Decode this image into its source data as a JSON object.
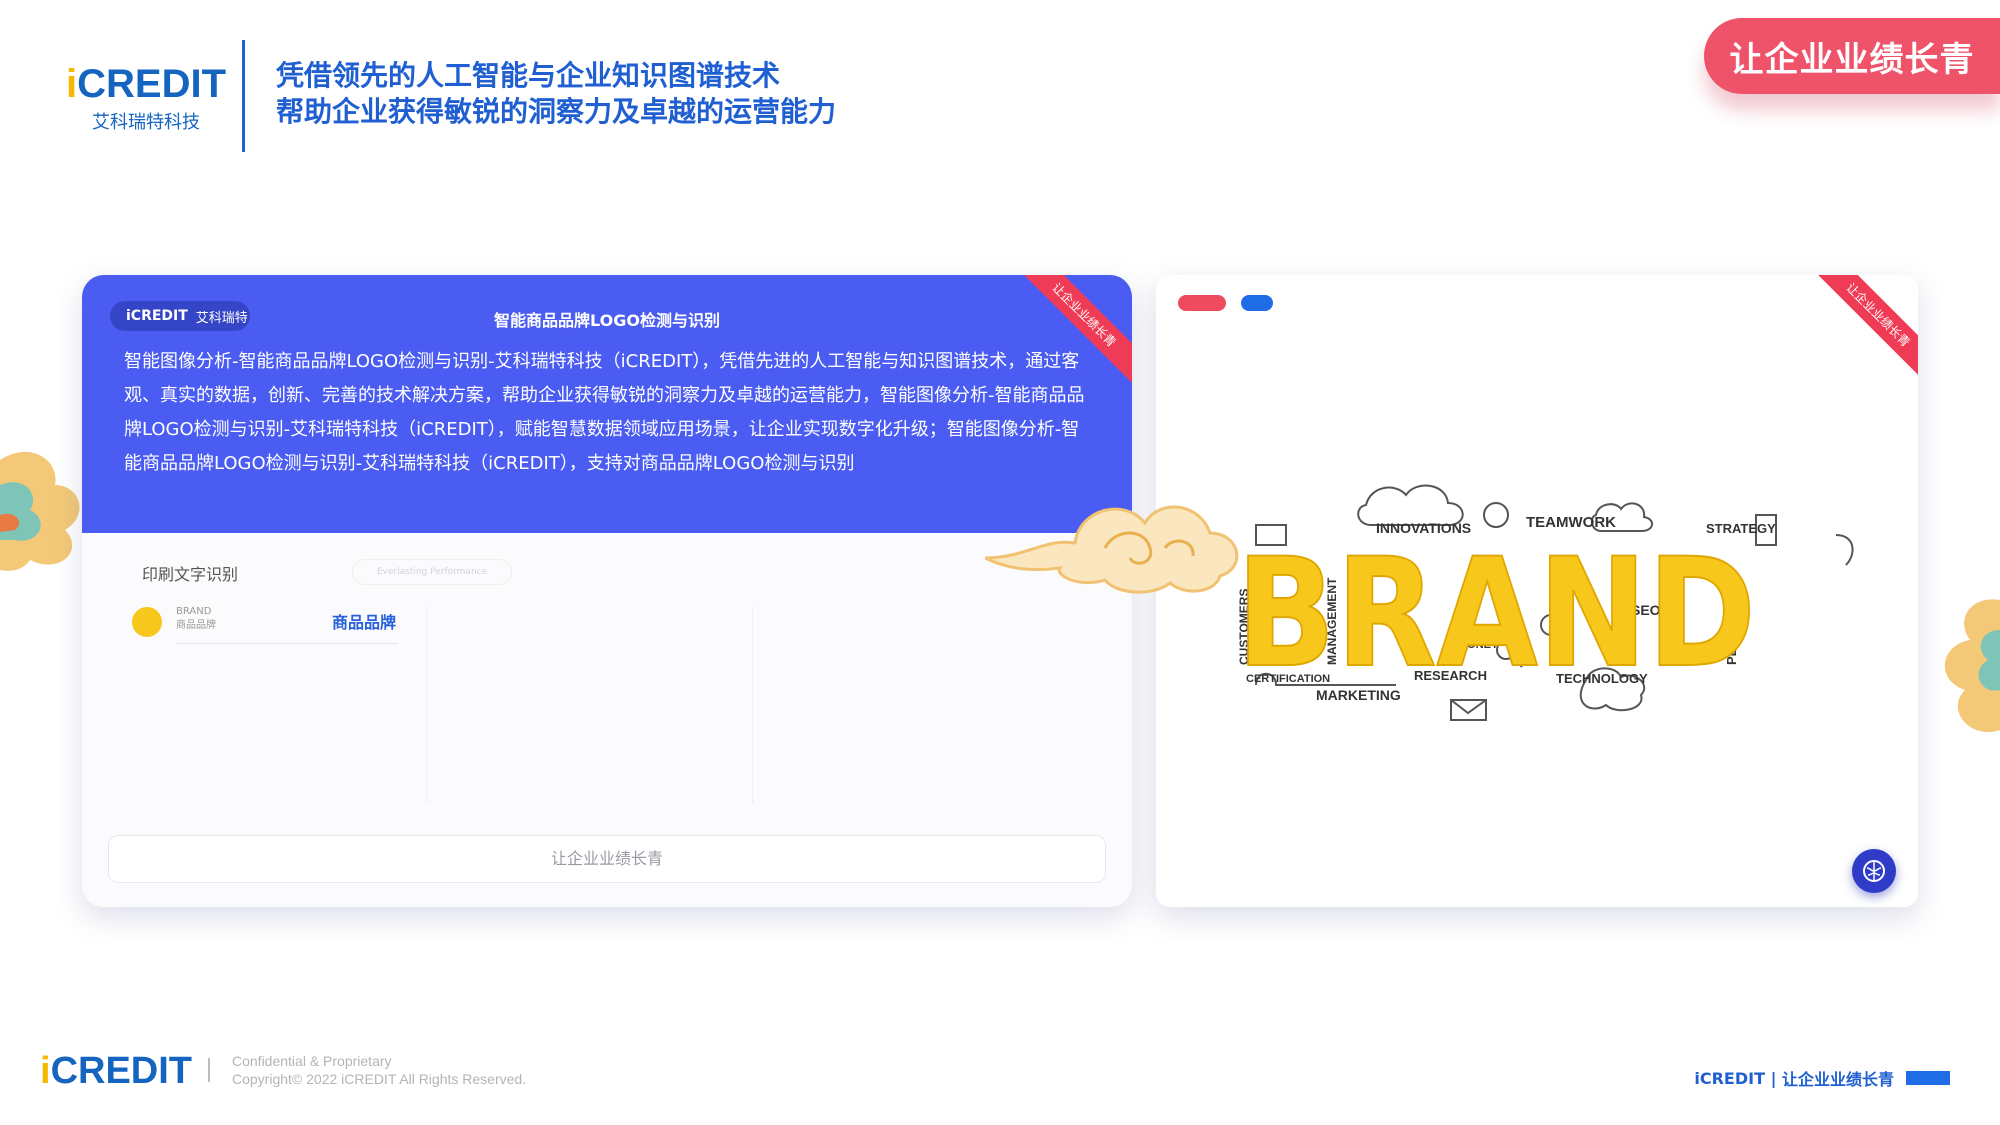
{
  "header": {
    "logo_word_i": "i",
    "logo_word_rest": "CREDIT",
    "logo_sub": "艾科瑞特科技",
    "headline_line1": "凭借领先的人工智能与企业知识图谱技术",
    "headline_line2": "帮助企业获得敏锐的洞察力及卓越的运营能力",
    "slogan": "让企业业绩长青"
  },
  "left_card": {
    "pill_brand": "iCREDIT",
    "pill_sub": "艾科瑞特",
    "title": "智能商品品牌LOGO检测与识别",
    "ribbon": "让企业业绩长青",
    "description": "智能图像分析-智能商品品牌LOGO检测与识别-艾科瑞特科技（iCREDIT），凭借先进的人工智能与知识图谱技术，通过客观、真实的数据，创新、完善的技术解决方案，帮助企业获得敏锐的洞察力及卓越的运营能力，智能图像分析-智能商品品牌LOGO检测与识别-艾科瑞特科技（iCREDIT），赋能智慧数据领域应用场景，让企业实现数字化升级；智能图像分析-智能商品品牌LOGO检测与识别-艾科瑞特科技（iCREDIT），支持对商品品牌LOGO检测与识别",
    "section_label": "印刷文字识别",
    "ghost_pill": "Everlasting Performance",
    "item_en": "BRAND",
    "item_cn": "商品品牌",
    "item_link": "商品品牌",
    "footer_button": "让企业业绩长青"
  },
  "right_card": {
    "ribbon": "让企业业绩长青",
    "image_words": {
      "main": "BRAND",
      "innovations": "INNOVATIONS",
      "teamwork": "TEAMWORK",
      "strategy": "STRATEGY",
      "customers": "CUSTOMERS",
      "management": "MANAGEMENT",
      "seo": "SEO",
      "planning": "PLANNING",
      "money": "MONEY",
      "certification": "CERTIFICATION",
      "research": "RESEARCH",
      "technology": "TECHNOLOGY",
      "marketing": "MARKETING"
    }
  },
  "footer": {
    "logo_i": "i",
    "logo_rest": "CREDIT",
    "copy_line1": "Confidential & Proprietary",
    "copy_line2": "Copyright© 2022 iCREDIT All Rights Reserved.",
    "right_brand": "iCREDIT",
    "right_sep": "|",
    "right_slogan": "让企业业绩长青"
  },
  "colors": {
    "accent_blue": "#1f5fd1",
    "card_blue": "#4a5cf2",
    "slogan_red": "#ef5369",
    "brand_yellow": "#f8c71c"
  }
}
